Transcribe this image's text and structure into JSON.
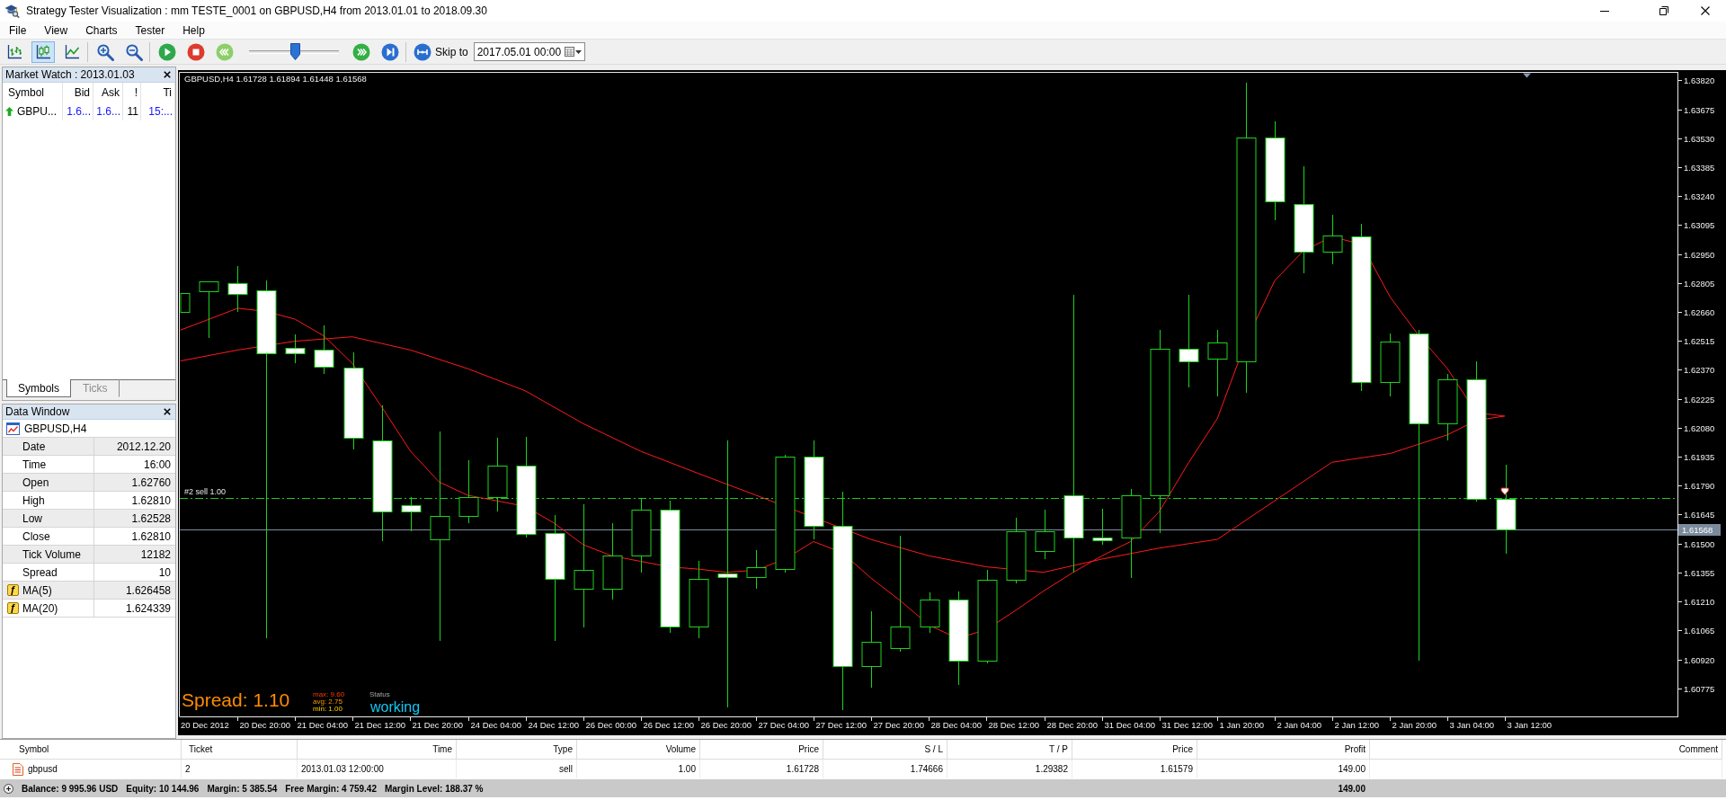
{
  "window": {
    "title": "Strategy Tester Visualization : mm TESTE_0001 on GBPUSD,H4 from 2013.01.01 to 2018.09.30"
  },
  "menu": [
    "File",
    "View",
    "Charts",
    "Tester",
    "Help"
  ],
  "toolbar": {
    "chart_types": [
      {
        "kind": "bars",
        "selected": false
      },
      {
        "kind": "candles",
        "selected": true
      },
      {
        "kind": "line",
        "selected": false
      }
    ],
    "speed_slider": {
      "level": 0.52
    },
    "skip_to": {
      "label": "Skip to",
      "date": "2017.05.01 00:00"
    }
  },
  "market_watch": {
    "title": "Market Watch : 2013.01.03",
    "columns": [
      "Symbol",
      "Bid",
      "Ask",
      "!",
      "Ti"
    ],
    "rows": [
      {
        "rising": true,
        "symbol": "GBPU...",
        "bid": "1.6...",
        "ask": "1.6...",
        "spread": "11",
        "time": "15:..."
      }
    ],
    "tabs": [
      {
        "label": "Symbols",
        "selected": true
      },
      {
        "label": "Ticks",
        "selected": false
      }
    ]
  },
  "data_window": {
    "title": "Data Window",
    "symbol": "GBPUSD,H4",
    "rows": [
      {
        "label": "Date",
        "value": "2012.12.20"
      },
      {
        "label": "Time",
        "value": "16:00"
      },
      {
        "label": "Open",
        "value": "1.62760"
      },
      {
        "label": "High",
        "value": "1.62810"
      },
      {
        "label": "Low",
        "value": "1.62528"
      },
      {
        "label": "Close",
        "value": "1.62810"
      },
      {
        "label": "Tick Volume",
        "value": "12182"
      },
      {
        "label": "Spread",
        "value": "10"
      },
      {
        "icon": "ƒ",
        "label": "MA(5)",
        "value": "1.626458"
      },
      {
        "icon": "ƒ",
        "label": "MA(20)",
        "value": "1.624339"
      }
    ]
  },
  "chart": {
    "info": "GBPUSD,H4 1.61728 1.61894 1.61448 1.61568",
    "order_line": {
      "label": "#2 sell 1.00"
    },
    "current_price": "1.61568",
    "price_axis": [
      "1.63820",
      "1.63675",
      "1.63530",
      "1.63385",
      "1.63240",
      "1.63095",
      "1.62950",
      "1.62805",
      "1.62660",
      "1.62515",
      "1.62370",
      "1.62225",
      "1.62080",
      "1.61935",
      "1.61790",
      "1.61645",
      "1.61500",
      "1.61355",
      "1.61210",
      "1.61065",
      "1.60920",
      "1.60775"
    ],
    "time_axis": [
      "20 Dec 2012",
      "20 Dec 20:00",
      "21 Dec 04:00",
      "21 Dec 12:00",
      "21 Dec 20:00",
      "24 Dec 04:00",
      "24 Dec 12:00",
      "26 Dec 00:00",
      "26 Dec 12:00",
      "26 Dec 20:00",
      "27 Dec 04:00",
      "27 Dec 12:00",
      "27 Dec 20:00",
      "28 Dec 04:00",
      "28 Dec 12:00",
      "28 Dec 20:00",
      "31 Dec 04:00",
      "31 Dec 12:00",
      "1 Jan 20:00",
      "2 Jan 04:00",
      "2 Jan 12:00",
      "2 Jan 20:00",
      "3 Jan 04:00",
      "3 Jan 12:00"
    ],
    "spread": {
      "value": "Spread: 1.10",
      "stats": [
        "max: 9.60",
        "avg: 2.75",
        "min: 1.00"
      ]
    },
    "status": {
      "label": "Status",
      "value": "working"
    }
  },
  "terminal": {
    "columns": [
      "Symbol",
      "Ticket",
      "Time",
      "Type",
      "Volume",
      "Price",
      "S / L",
      "T / P",
      "Price",
      "Profit",
      "Comment"
    ],
    "rows": [
      {
        "symbol": "gbpusd",
        "ticket": "2",
        "time": "2013.01.03 12:00:00",
        "type": "sell",
        "volume": "1.00",
        "price": "1.61728",
        "sl": "1.74666",
        "tp": "1.29382",
        "current_price": "1.61579",
        "profit": "149.00"
      }
    ],
    "summary": {
      "items": [
        "Balance: 9 995.96 USD",
        "Equity: 10 144.96",
        "Margin: 5 385.54",
        "Free Margin: 4 759.42",
        "Margin Level: 188.37 %"
      ],
      "profit": "149.00"
    }
  }
}
